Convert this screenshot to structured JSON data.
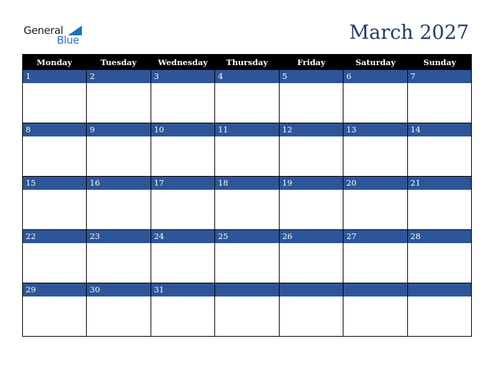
{
  "logo": {
    "line1": "General",
    "line2": "Blue"
  },
  "title": "March 2027",
  "colors": {
    "header_bg": "#000000",
    "band_bg": "#2e5597",
    "title": "#233a6a",
    "logo_blue": "#1f6fc0"
  },
  "weekdays": [
    "Monday",
    "Tuesday",
    "Wednesday",
    "Thursday",
    "Friday",
    "Saturday",
    "Sunday"
  ],
  "weeks": [
    [
      "1",
      "2",
      "3",
      "4",
      "5",
      "6",
      "7"
    ],
    [
      "8",
      "9",
      "10",
      "11",
      "12",
      "13",
      "14"
    ],
    [
      "15",
      "16",
      "17",
      "18",
      "19",
      "20",
      "21"
    ],
    [
      "22",
      "23",
      "24",
      "25",
      "26",
      "27",
      "28"
    ],
    [
      "29",
      "30",
      "31",
      "",
      "",
      "",
      ""
    ]
  ]
}
